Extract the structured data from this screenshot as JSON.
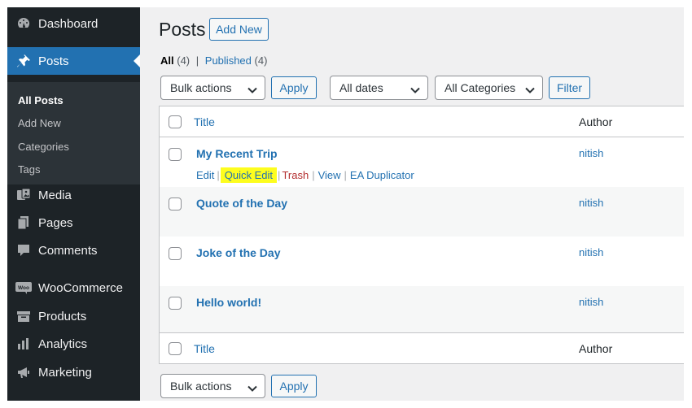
{
  "sidebar": {
    "dashboard": "Dashboard",
    "posts": "Posts",
    "submenu": [
      "All Posts",
      "Add New",
      "Categories",
      "Tags"
    ],
    "media": "Media",
    "pages": "Pages",
    "comments": "Comments",
    "woocommerce": "WooCommerce",
    "woo_badge": "Woo",
    "products": "Products",
    "analytics": "Analytics",
    "marketing": "Marketing"
  },
  "header": {
    "title": "Posts",
    "add_new": "Add New"
  },
  "views": {
    "all_label": "All",
    "all_count": "(4)",
    "separator": "|",
    "published_label": "Published",
    "published_count": "(4)"
  },
  "toolbar": {
    "bulk_actions": "Bulk actions",
    "apply": "Apply",
    "dates": "All dates",
    "categories": "All Categories",
    "filter": "Filter"
  },
  "table": {
    "columns": {
      "title": "Title",
      "author": "Author"
    },
    "rows": [
      {
        "title": "My Recent Trip",
        "author": "nitish"
      },
      {
        "title": "Quote of the Day",
        "author": "nitish"
      },
      {
        "title": "Joke of the Day",
        "author": "nitish"
      },
      {
        "title": "Hello world!",
        "author": "nitish"
      }
    ],
    "row_actions": {
      "edit": "Edit",
      "quick_edit": "Quick Edit",
      "trash": "Trash",
      "view": "View",
      "duplicator": "EA Duplicator",
      "sep": "|"
    }
  },
  "bottom_toolbar": {
    "bulk_actions": "Bulk actions",
    "apply": "Apply"
  },
  "colors": {
    "sidebar_bg": "#1d2327",
    "accent": "#2271b1",
    "highlight": "#fdfd1e",
    "trash": "#b32d2e"
  }
}
